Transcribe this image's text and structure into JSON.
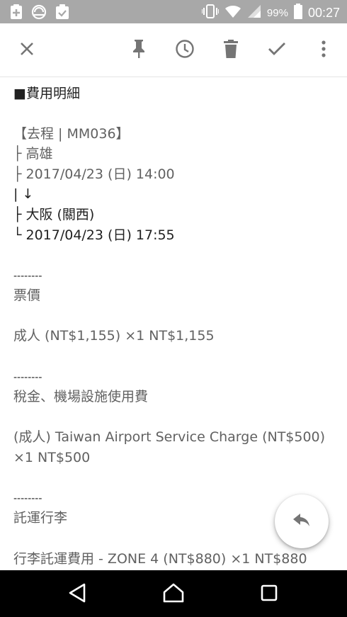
{
  "status_bar": {
    "icons_left": [
      "add-box-icon",
      "lens-app-icon",
      "clipboard-check-icon"
    ],
    "icons_right": [
      "vibrate-icon",
      "wifi-icon",
      "signal-icon",
      "battery-icon"
    ],
    "battery": "99%",
    "time": "00:27"
  },
  "toolbar": {
    "icons": [
      "close-icon",
      "pin-icon",
      "clock-icon",
      "trash-icon",
      "check-icon",
      "more-vert-icon"
    ]
  },
  "content": {
    "heading": "■費用明細",
    "lines": [
      "【去程 | MM036】",
      "├ 高雄",
      "├ 2017/04/23 (日) 14:00",
      "|  ↓",
      "├ 大阪 (關西)",
      "└ 2017/04/23 (日) 17:55",
      "--------",
      "票價",
      "成人 (NT$1,155) ×1 NT$1,155",
      "--------",
      "稅金、機場設施使用費",
      "(成人) Taiwan Airport Service Charge (NT$500)",
      "×1 NT$500",
      "--------",
      "託運行李",
      "行李託運費用 - ZONE 4 (NT$880) ×1 NT$880"
    ]
  },
  "fab": {
    "icon": "reply-icon"
  },
  "nav_bar": {
    "icons": [
      "back-icon",
      "home-icon",
      "recents-icon"
    ]
  },
  "colors": {
    "status_bar": "#a8a8a8",
    "toolbar_icons": "#757575",
    "text": "#616161",
    "text_dark": "#212121",
    "nav_bar": "#000000"
  }
}
